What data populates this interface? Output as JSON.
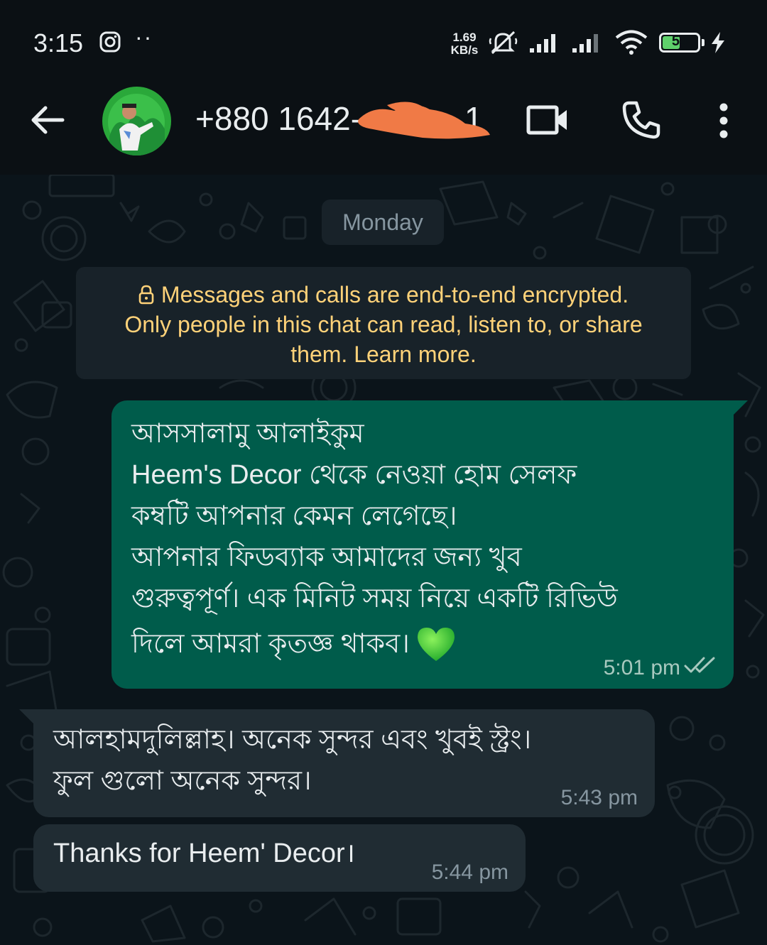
{
  "status_bar": {
    "time": "3:15",
    "net_speed_value": "1.69",
    "net_speed_unit": "KB/s",
    "battery": "54",
    "battery_level": 0.54
  },
  "header": {
    "contact_name": "+880 1642-",
    "contact_tail": "1"
  },
  "chat": {
    "date_label": "Monday",
    "encryption_notice": {
      "line1": "Messages and calls are end-to-end encrypted.",
      "line2": "Only people in this chat can read, listen to, or share",
      "line3": "them. Learn more."
    },
    "messages": [
      {
        "direction": "outgoing",
        "lines": [
          "আসসালামু আলাইকুম",
          "Heem's Decor থেকে নেওয়া হোম সেলফ",
          "কম্বটি আপনার কেমন লেগেছে।",
          "আপনার ফিডব্যাক আমাদের জন্য খুব",
          "গুরুত্বপূর্ণ। এক মিনিট সময় নিয়ে একটি রিভিউ",
          "দিলে আমরা কৃতজ্ঞ থাকব।"
        ],
        "time": "5:01 pm"
      },
      {
        "direction": "incoming",
        "lines": [
          "আলহামদুলিল্লাহ। অনেক সুন্দর এবং খুবই স্ট্রং।",
          "ফুল গুলো অনেক সুন্দর।"
        ],
        "time": "5:43 pm"
      },
      {
        "direction": "incoming",
        "lines": [
          "Thanks for Heem' Decor।"
        ],
        "time": "5:44 pm"
      }
    ]
  },
  "colors": {
    "background": "#0b141a",
    "outgoing_bubble": "#005c4b",
    "incoming_bubble": "#202c33",
    "notice_text": "#ffd279",
    "read_ticks": "#a8c9bf"
  },
  "icons": {
    "status": [
      "instagram-icon",
      "mute-icon",
      "signal-icon",
      "wifi-icon",
      "battery-icon",
      "charging-icon"
    ],
    "header": [
      "back-arrow-icon",
      "video-call-icon",
      "voice-call-icon",
      "more-options-icon"
    ],
    "chat": [
      "lock-icon",
      "green-heart-icon",
      "double-check-icon"
    ]
  }
}
